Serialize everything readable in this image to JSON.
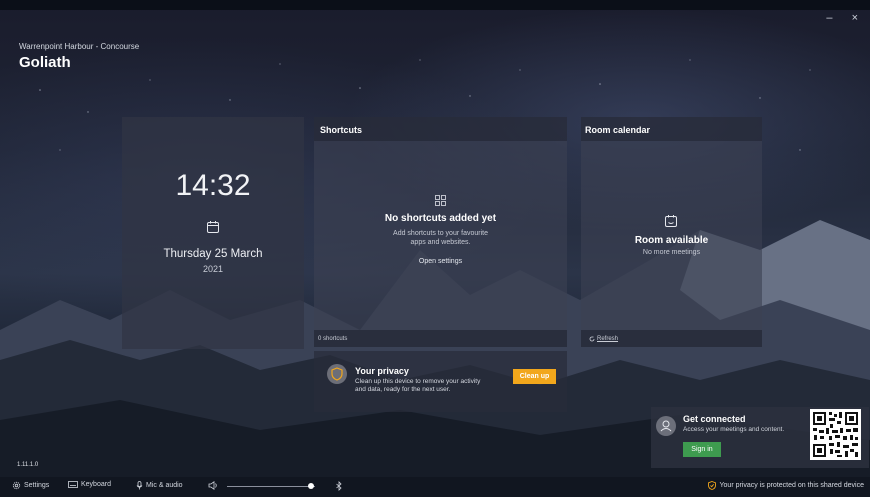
{
  "window": {
    "controls": "– ×"
  },
  "header": {
    "location": "Warrenpoint Harbour - Concourse",
    "room_name": "Goliath"
  },
  "clock": {
    "time": "14:32",
    "date_line": "Thursday 25 March",
    "year": "2021"
  },
  "shortcuts": {
    "title": "Shortcuts",
    "empty_title": "No shortcuts added yet",
    "empty_desc_1": "Add shortcuts to your favourite",
    "empty_desc_2": "apps and websites.",
    "open_settings": "Open settings",
    "footer": "0 shortcuts"
  },
  "room_calendar": {
    "title": "Room calendar",
    "status": "Room available",
    "sub": "No more meetings",
    "refresh": "Refresh"
  },
  "privacy_card": {
    "title": "Your privacy",
    "desc_1": "Clean up this device to remove your activity",
    "desc_2": "and data, ready for the next user.",
    "button": "Clean up"
  },
  "connect_card": {
    "title": "Get connected",
    "desc": "Access your meetings and content.",
    "button": "Sign in"
  },
  "version": "1.11.1.0",
  "bottom_bar": {
    "settings": "Settings",
    "keyboard": "Keyboard",
    "mic_audio": "Mic & audio",
    "volume_level": 0.95,
    "privacy_note": "Your privacy is protected on this shared device"
  },
  "colors": {
    "accent": "#f2a71c",
    "sign_in": "#3e9b4f"
  }
}
